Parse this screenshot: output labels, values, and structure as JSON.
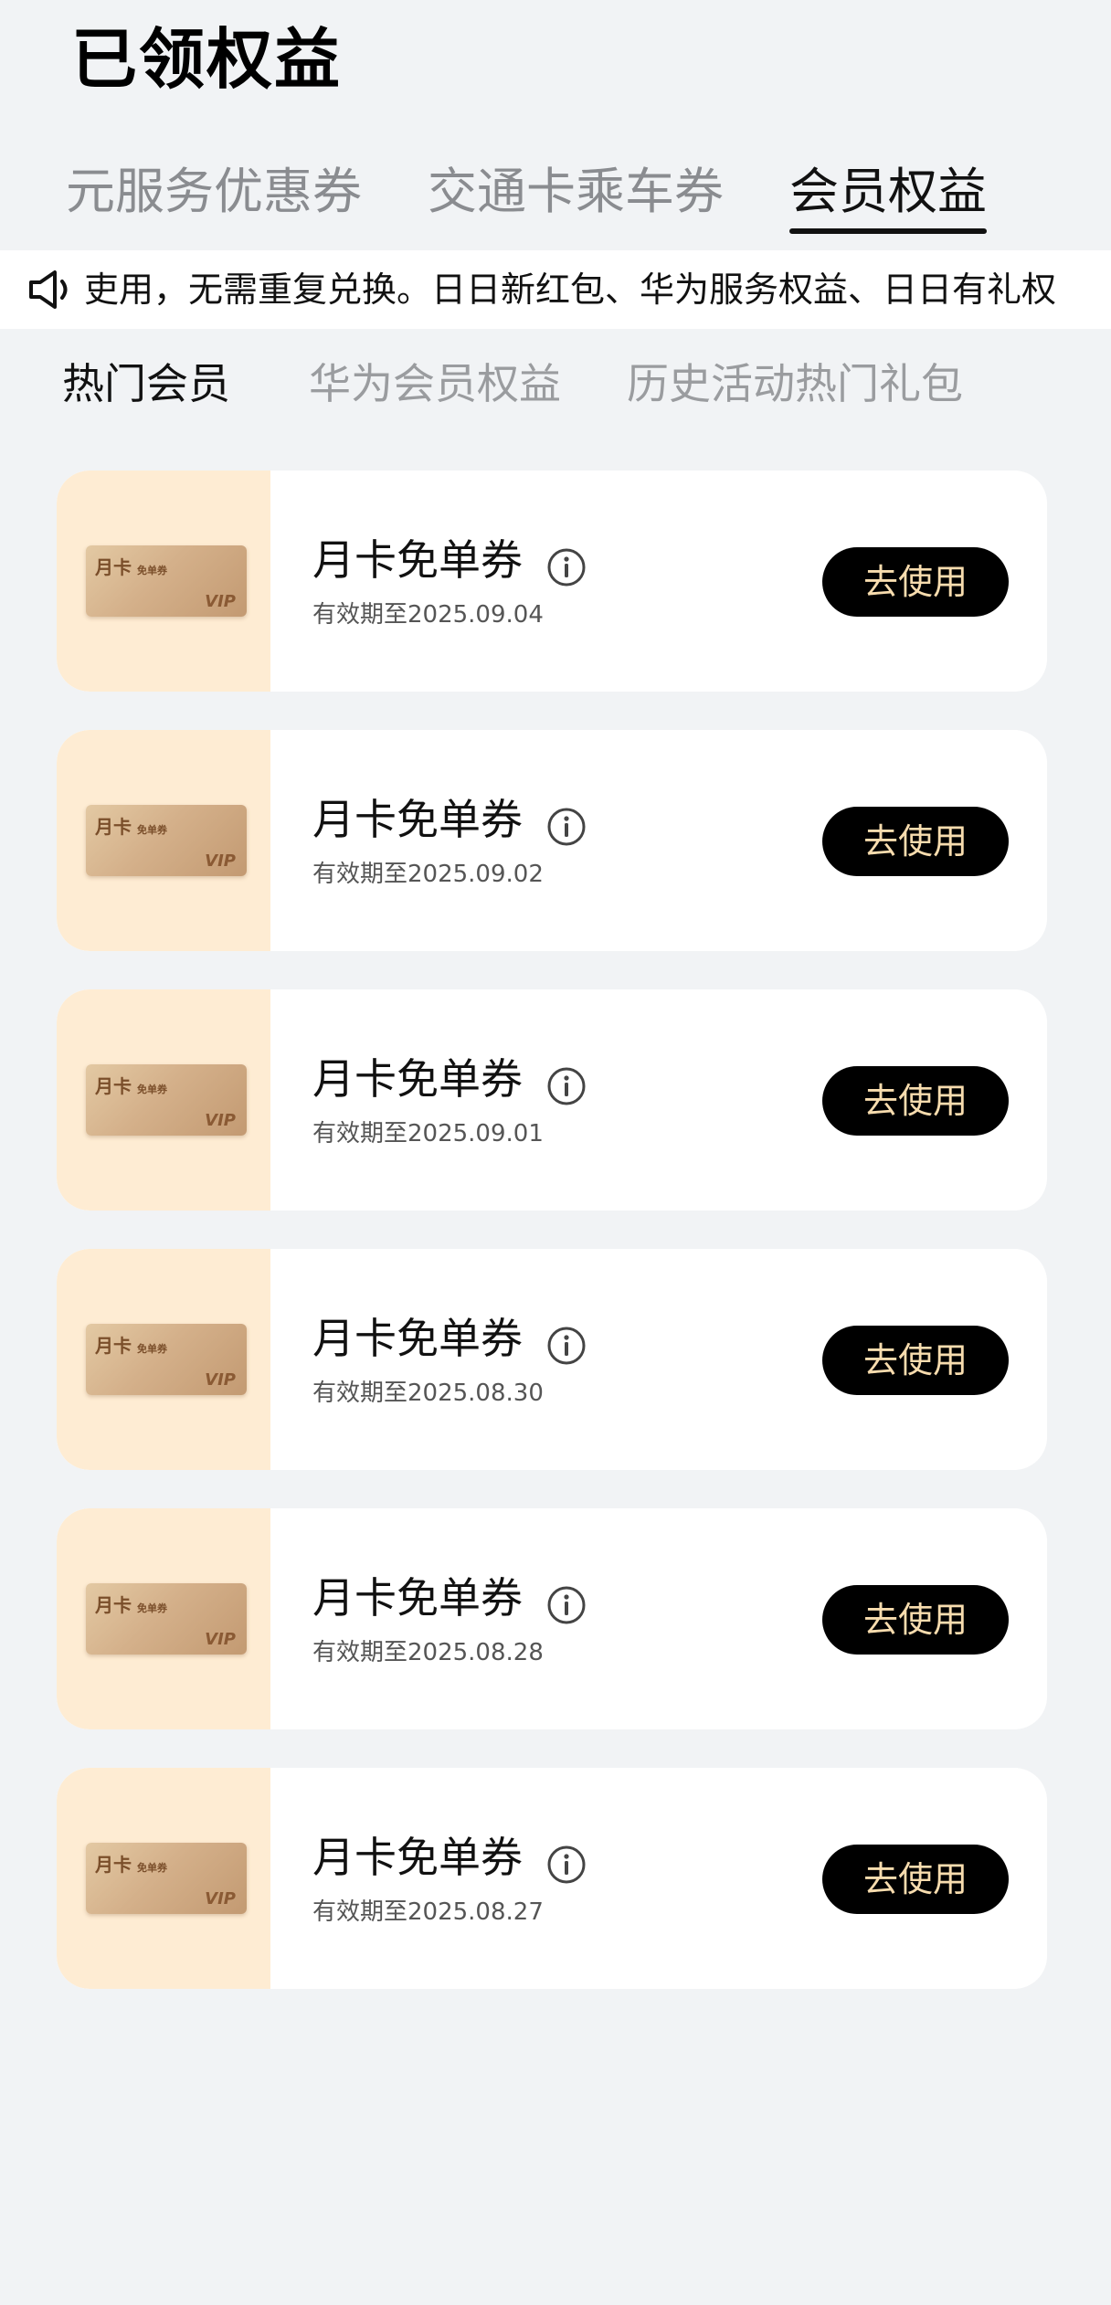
{
  "page": {
    "title": "已领权益"
  },
  "top_tabs": [
    {
      "label": "元服务优惠券",
      "active": false
    },
    {
      "label": "交通卡乘车券",
      "active": false
    },
    {
      "label": "会员权益",
      "active": true
    }
  ],
  "notice": {
    "icon": "speaker-icon",
    "text": "吏用，无需重复兑换。日日新红包、华为服务权益、日日有礼权"
  },
  "sub_tabs": [
    {
      "label": "热门会员",
      "active": true
    },
    {
      "label": "华为会员权益",
      "active": false
    },
    {
      "label": "历史活动热门礼包",
      "active": false
    }
  ],
  "coupon_thumb": {
    "label": "月卡",
    "sub": "免单券",
    "badge": "VIP"
  },
  "coupons": [
    {
      "title": "月卡免单券",
      "expiry": "有效期至2025.09.04",
      "button": "去使用"
    },
    {
      "title": "月卡免单券",
      "expiry": "有效期至2025.09.02",
      "button": "去使用"
    },
    {
      "title": "月卡免单券",
      "expiry": "有效期至2025.09.01",
      "button": "去使用"
    },
    {
      "title": "月卡免单券",
      "expiry": "有效期至2025.08.30",
      "button": "去使用"
    },
    {
      "title": "月卡免单券",
      "expiry": "有效期至2025.08.28",
      "button": "去使用"
    },
    {
      "title": "月卡免单券",
      "expiry": "有效期至2025.08.27",
      "button": "去使用"
    }
  ],
  "colors": {
    "background": "#f1f3f5",
    "thumb_bg": "#feecd3",
    "button_bg": "#000000",
    "button_text": "#f7dcae",
    "inactive_tab": "#8a8c90"
  }
}
